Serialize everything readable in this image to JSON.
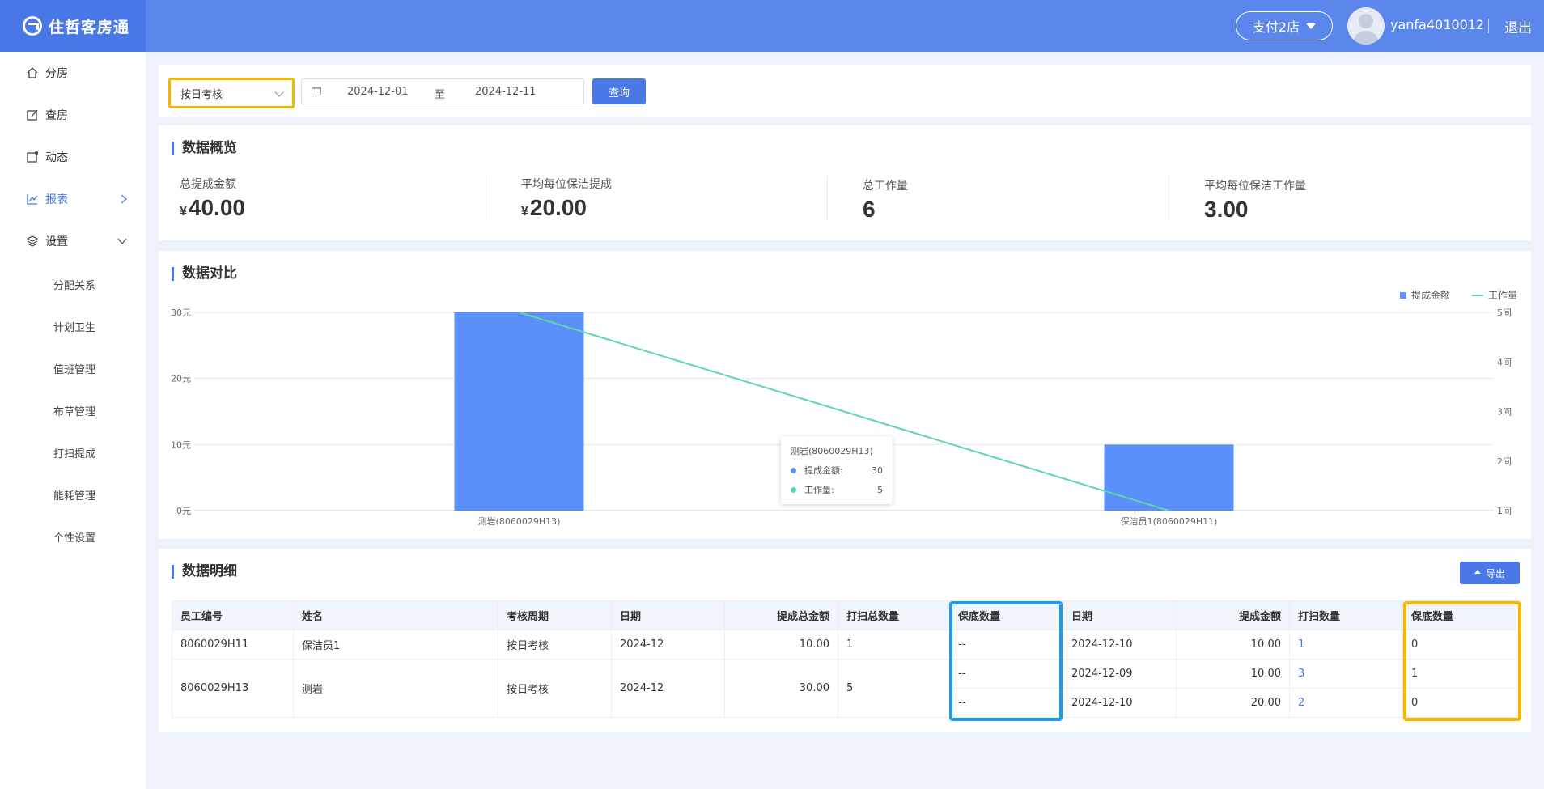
{
  "app": {
    "name": "住哲客房通"
  },
  "header": {
    "store": "支付2店",
    "username": "yanfa4010012",
    "logout": "退出"
  },
  "sidebar": {
    "items": [
      {
        "label": "分房",
        "icon": "home-icon"
      },
      {
        "label": "查房",
        "icon": "edit-icon"
      },
      {
        "label": "动态",
        "icon": "activity-icon"
      },
      {
        "label": "报表",
        "icon": "chart-icon"
      },
      {
        "label": "设置",
        "icon": "layers-icon"
      }
    ],
    "sub_items": [
      "分配关系",
      "计划卫生",
      "值班管理",
      "布草管理",
      "打扫提成",
      "能耗管理",
      "个性设置"
    ]
  },
  "filter": {
    "mode": "按日考核",
    "date_start": "2024-12-01",
    "date_to": "至",
    "date_end": "2024-12-11",
    "query": "查询"
  },
  "overview": {
    "title": "数据概览",
    "currency": "¥",
    "stats": [
      {
        "label": "总提成金额",
        "value": "40.00",
        "currency": true
      },
      {
        "label": "平均每位保洁提成",
        "value": "20.00",
        "currency": true
      },
      {
        "label": "总工作量",
        "value": "6",
        "currency": false
      },
      {
        "label": "平均每位保洁工作量",
        "value": "3.00",
        "currency": false
      }
    ]
  },
  "comparison": {
    "title": "数据对比",
    "tooltip": {
      "title": "测岩(8060029H13)",
      "rows": [
        {
          "label": "提成金额:",
          "value": "30"
        },
        {
          "label": "工作量:",
          "value": "5"
        }
      ]
    }
  },
  "chart_data": {
    "type": "bar",
    "categories": [
      "测岩(8060029H13)",
      "保洁员1(8060029H11)"
    ],
    "series": [
      {
        "name": "提成金额",
        "type": "bar",
        "values": [
          30,
          10
        ],
        "axis": "left",
        "color": "#5b8ff9"
      },
      {
        "name": "工作量",
        "type": "line",
        "values": [
          5,
          1
        ],
        "axis": "right",
        "color": "#5ad8a6"
      }
    ],
    "y_left": {
      "ticks": [
        "0元",
        "10元",
        "20元",
        "30元"
      ],
      "ylim": [
        0,
        30
      ]
    },
    "y_right": {
      "ticks": [
        "1间",
        "2间",
        "3间",
        "4间",
        "5间"
      ],
      "ylim": [
        1,
        5
      ]
    },
    "legend_position": "top-right",
    "grid": true
  },
  "detail": {
    "title": "数据明细",
    "export": "导出",
    "columns": [
      "员工编号",
      "姓名",
      "考核周期",
      "日期",
      "提成总金额",
      "打扫总数量",
      "保底数量",
      "日期",
      "提成金额",
      "打扫数量",
      "保底数量"
    ],
    "rows": [
      {
        "emp_id": "8060029H11",
        "name": "保洁员1",
        "period": "按日考核",
        "month": "2024-12",
        "total": "10.00",
        "total_count": "1",
        "subs": [
          {
            "floor": "--",
            "date": "2024-12-10",
            "amount": "10.00",
            "count": "1",
            "base": "0"
          }
        ]
      },
      {
        "emp_id": "8060029H13",
        "name": "测岩",
        "period": "按日考核",
        "month": "2024-12",
        "total": "30.00",
        "total_count": "5",
        "subs": [
          {
            "floor": "--",
            "date": "2024-12-09",
            "amount": "10.00",
            "count": "3",
            "base": "1"
          },
          {
            "floor": "--",
            "date": "2024-12-10",
            "amount": "20.00",
            "count": "2",
            "base": "0"
          }
        ]
      }
    ]
  }
}
